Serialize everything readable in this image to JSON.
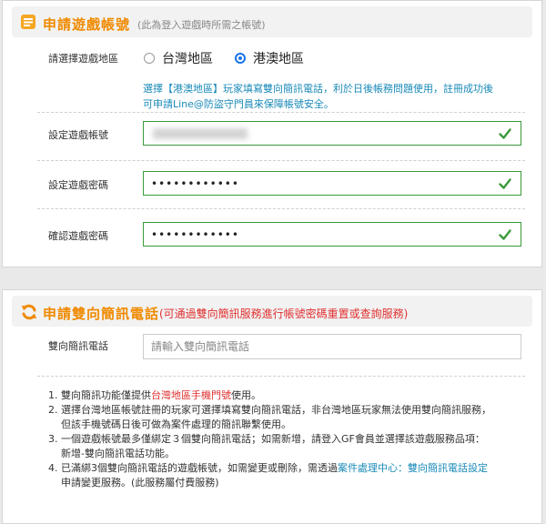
{
  "account_section": {
    "title": "申請遊戲帳號",
    "note": "(此為登入遊戲時所需之帳號)",
    "region": {
      "label": "請選擇遊戲地區",
      "options": [
        "台灣地區",
        "港澳地區"
      ],
      "selected": "港澳地區"
    },
    "hint_line1": "選擇【港澳地區】玩家填寫雙向簡訊電話，利於日後帳務問題使用，註冊成功後",
    "hint_line2": "可申請Line@防盜守門員來保障帳號安全。",
    "account_label": "設定遊戲帳號",
    "password_label": "設定遊戲密碼",
    "password_value": "••••••••••••",
    "confirm_label": "確認遊戲密碼",
    "confirm_value": "••••••••••••"
  },
  "sms_section": {
    "title": "申請雙向簡訊電話",
    "note": "(可通過雙向簡訊服務進行帳號密碼重置或查詢服務)",
    "phone_label": "雙向簡訊電話",
    "phone_placeholder": "請輸入雙向簡訊電話",
    "notes": {
      "n1_num": "1.",
      "n1_a": "雙向簡訊功能僅提供",
      "n1_red": "台灣地區手機門號",
      "n1_b": "使用。",
      "n2_num": "2.",
      "n2_line1": "選擇台灣地區帳號註冊的玩家可選擇填寫雙向簡訊電話，非台灣地區玩家無法使用雙向簡訊服務，",
      "n2_line2": "但該手機號碼日後可做為案件處理的簡訊聯繫使用。",
      "n3_num": "3.",
      "n3_line1": "一個遊戲帳號最多僅綁定３個雙向簡訊電話；如需新增，請登入GF會員並選擇該遊戲服務品項：",
      "n3_line2": "新增-雙向簡訊電話功能。",
      "n4_num": "4.",
      "n4_a": "已滿綁3個雙向簡訊電話的遊戲帳號，如需變更或刪除，需透過",
      "n4_link": "案件處理中心：雙向簡訊電話設定",
      "n4_line2": "申請變更服務。(此服務屬付費服務)"
    }
  },
  "colors": {
    "accent": "#f08a00",
    "valid": "#3b9a3b",
    "link": "#1a8ab8",
    "warning": "#e03030"
  }
}
